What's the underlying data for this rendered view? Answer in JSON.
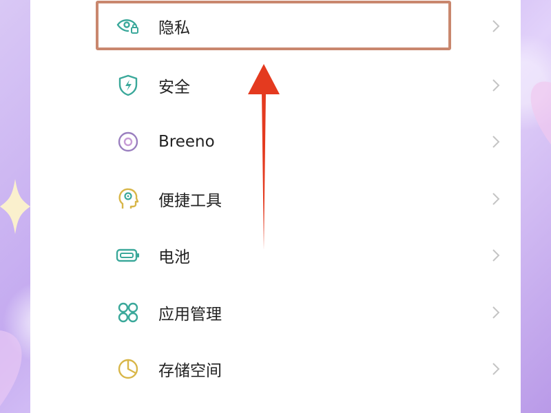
{
  "settings": {
    "items": [
      {
        "label": "隐私",
        "icon": "privacy-eye-lock-icon"
      },
      {
        "label": "安全",
        "icon": "security-shield-icon"
      },
      {
        "label": "Breeno",
        "icon": "breeno-icon"
      },
      {
        "label": "便捷工具",
        "icon": "convenience-tools-icon"
      },
      {
        "label": "电池",
        "icon": "battery-icon"
      },
      {
        "label": "应用管理",
        "icon": "app-management-icon"
      },
      {
        "label": "存储空间",
        "icon": "storage-pie-icon"
      }
    ]
  },
  "colors": {
    "icon_teal": "#3aa89a",
    "icon_purple": "#9a7fbf",
    "icon_yellow": "#d8b648",
    "highlight": "#c9876e",
    "arrow": "#e43a1f",
    "chevron": "#c4c4c4"
  }
}
